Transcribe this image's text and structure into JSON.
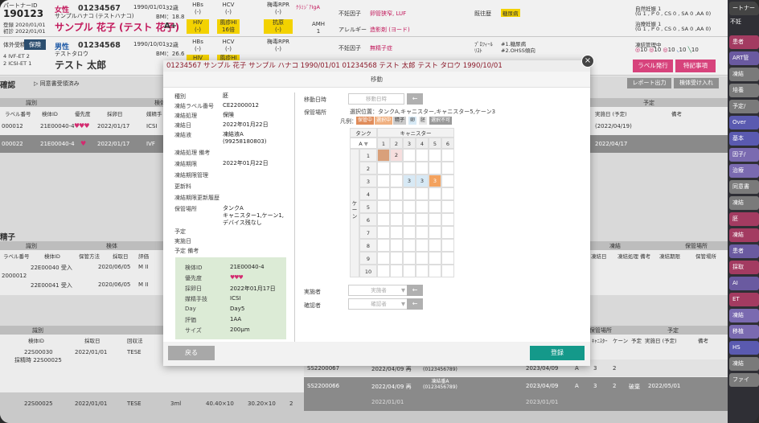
{
  "patients": [
    {
      "id_label": "パートナーID",
      "id": "190123",
      "reg_date_1": "登録 2020/01/01",
      "reg_date_2": "初診 2022/01/01",
      "sex": "女性",
      "card": "01234567",
      "kana": "サンプルハナコ (テストハナコ)",
      "name": "サンプル 花子 (テスト 花子)",
      "blood": "A+",
      "dob": "1990/01/01",
      "age": "32歳",
      "bmi": "BMI：18.8"
    },
    {
      "flow_label": "体外受精",
      "insurance": "保険",
      "sex": "男性",
      "card": "01234568",
      "kana": "テストタロウ",
      "name": "テスト 太郎",
      "dob": "1990/10/01",
      "age": "32歳",
      "bmi": "BMI：26.6",
      "side_1": "4  IVF-ET 2",
      "side_2": "2  ICSI-ET 1"
    }
  ],
  "infection": {
    "hdr": [
      "HBs",
      "HCV",
      "梅毒RPR"
    ],
    "p1": [
      "(-)",
      "(-)",
      "(-)"
    ],
    "hdr2": [
      "HIV",
      "風疹HI",
      "抗原"
    ],
    "p1b": [
      "(-)",
      "16倍",
      "(-)"
    ],
    "p2": [
      "(-)",
      "(-)",
      "(-)"
    ],
    "hdr3": [
      "HBs",
      "HCV",
      "梅毒RPR"
    ],
    "hdr4": [
      "HIV",
      "風疹HI"
    ]
  },
  "clinical": {
    "chlamydia_label": "ｸﾗﾐｼﾞｱIgA",
    "amh_label": "AMH",
    "amh_value": "1",
    "infertility_label": "不妊因子",
    "infertility_value": "卵管狭窄, LUF",
    "allergy_label": "アレルギー",
    "allergy_value": "造影剤 (ヨード)",
    "history_label": "既往歴",
    "history_value": "糖尿病",
    "male_factor_label": "不妊因子",
    "male_factor_value": "無精子症",
    "profile_label": "ﾌﾟﾛﾌｨｰﾙ\nﾘｽﾄ",
    "profile_value": "#1.糖尿病\n#2.OHSS傾向",
    "natural_1": "自然妊娠 1",
    "natural_1_detail": "(G 1 , P 0 , CS 0 , SA 0 ,AA 0)",
    "treatment_1": "治療妊娠 1",
    "treatment_1_detail": "(G 1 , P 0 , CS 0 , SA 0 ,AA 0)",
    "frozen_label": "凍結管理中",
    "frozen_counts": [
      "10",
      "10",
      "10",
      "10",
      "10"
    ]
  },
  "toolbar": {
    "label_print": "ラベル発行",
    "special": "特記事項",
    "report": "レポート出力",
    "accept": "検体受け入れ",
    "confirm_title": "確認",
    "consent": "▷ 同意書受領済み"
  },
  "sidebar_items": [
    "ートナー",
    "不妊",
    "患者",
    "ART管",
    "凍結",
    "培養",
    "予定/",
    "Over",
    "基本",
    "因子/",
    "治療",
    "同意書",
    "凍結",
    "胚",
    "凍結",
    "患者",
    "採取",
    "AI",
    "ET",
    "凍結",
    "移植",
    "HS",
    "凍結",
    "ファイ"
  ],
  "sidebar_flag": "不妊",
  "bg_table1": {
    "hdr_left": "識別",
    "hdr_mid": "検体",
    "cols": [
      "ラベル番号",
      "検体ID",
      "優先度",
      "採卵日",
      "媒精手"
    ],
    "rows": [
      [
        "000012",
        "21E00040-4",
        "♥♥♥",
        "2022/01/17",
        "ICSI"
      ],
      [
        "000022",
        "21E00040-4",
        "♥",
        "2022/01/17",
        "IVF"
      ]
    ],
    "right_hdr": "予定",
    "right_cols": [
      "実施日 (予定)",
      "備考"
    ],
    "right_rows": [
      "(2022/04/19)",
      "2022/04/17"
    ]
  },
  "bg_table2": {
    "section": "精子",
    "hdr_left": "識別",
    "hdr_mid": "検体",
    "cols": [
      "ラベル番号",
      "検体ID",
      "保管方法",
      "採取日",
      "評価"
    ],
    "group": "2000012",
    "rows": [
      [
        "22E00040 受入",
        "2020/06/05",
        "M II"
      ],
      [
        "22E00041 受入",
        "2020/06/05",
        "M II"
      ]
    ],
    "right_hdr": "凍結",
    "right_hdr2": "保管場所",
    "right_cols": [
      "凍結日",
      "凍結処理 備考",
      "凍結期限",
      "保管場所"
    ]
  },
  "bg_table3": {
    "hdr": "識別",
    "cols": [
      "検体ID",
      "採取日",
      "回収法"
    ],
    "rows": [
      [
        "22S00030",
        "2022/01/01",
        "TESE"
      ],
      [
        "22S00025",
        "2022/01/01",
        "TESE"
      ]
    ],
    "sub": "採精時 22S00025",
    "extra": [
      "3ml",
      "40.40×10",
      "30.20×10",
      "2"
    ],
    "storage_hdr": "保管場所",
    "storage_cols": [
      "ﾀﾝｸ",
      "ｷｬﾆｽﾀｰ",
      "ケーン",
      "予定",
      "実施日 (予定)",
      "備考"
    ],
    "s_rows": [
      [
        "SS2200067",
        "2022/04/09 再",
        "凍結番A\n(0123456789)",
        "2023/04/09",
        "A",
        "3",
        "2",
        "",
        ""
      ],
      [
        "SS2200066",
        "2022/04/09 再",
        "凍結番A\n(0123456789)",
        "2023/04/09",
        "A",
        "3",
        "2",
        "破棄",
        "2022/05/01"
      ],
      [
        "",
        "2022/01/01",
        "",
        "2023/01/01",
        "",
        "",
        "",
        "",
        ""
      ]
    ]
  },
  "modal": {
    "title": "01234567 サンプル 花子 サンプル ハナコ 1990/01/01 01234568 テスト 太郎 テスト タロウ 1990/10/01",
    "subtitle": "移動",
    "close": "×",
    "fields": [
      {
        "label": "種別",
        "value": "胚"
      },
      {
        "label": "凍結ラベル番号",
        "value": "CE22000012"
      },
      {
        "label": "凍結処理",
        "value": "保険"
      },
      {
        "label": "凍結日",
        "value": "2022年01月22日"
      },
      {
        "label": "凍結液",
        "value": "凍結液A\n(99258180803)"
      },
      {
        "label": "凍結処理 備考",
        "value": ""
      },
      {
        "label": "凍結期限",
        "value": "2022年01月22日"
      },
      {
        "label": "凍結期限管理",
        "value": ""
      },
      {
        "label": "更新料",
        "value": ""
      },
      {
        "label": "凍結期限更新履歴",
        "value": ""
      },
      {
        "label": "保管場所",
        "value": "タンクA\nキャニスター1,ケーン1,\nデバイス残なし"
      },
      {
        "label": "予定",
        "value": ""
      },
      {
        "label": "実施日",
        "value": ""
      },
      {
        "label": "予定 備考",
        "value": ""
      }
    ],
    "detail": [
      {
        "label": "検体ID",
        "value": "21E00040-4"
      },
      {
        "label": "優先度",
        "value": "♥♥♥"
      },
      {
        "label": "採卵日",
        "value": "2022年01月17日"
      },
      {
        "label": "媒精手技",
        "value": "ICSI"
      },
      {
        "label": "Day",
        "value": "Day5"
      },
      {
        "label": "評価",
        "value": "1AA"
      },
      {
        "label": "サイズ",
        "value": "200μm"
      }
    ],
    "move_date_label": "移動日時",
    "move_date_placeholder": "移動日時",
    "storage_label": "保管場所",
    "selected_position": "選択位置：タンクA,キャニスター,キャニスター5,ケーン3",
    "legend_label": "凡例：",
    "legend": [
      {
        "text": "保管中",
        "color": "#e08c5a"
      },
      {
        "text": "選択中",
        "color": "#f0b080"
      },
      {
        "text": "精子",
        "color": "#c9c9c9"
      },
      {
        "text": "卵",
        "color": "#d7e9f5"
      },
      {
        "text": "胚",
        "color": "#e7e7e7"
      },
      {
        "text": "選択不可",
        "color": "#9a9a9a"
      }
    ],
    "tank_label": "タンク",
    "canister_label": "キャニスター",
    "tank_value": "A",
    "cane_label": "ケーン",
    "col_headers": [
      "1",
      "2",
      "3",
      "4",
      "5",
      "6"
    ],
    "row_headers": [
      "1",
      "2",
      "3",
      "4",
      "5",
      "6",
      "7",
      "8",
      "9",
      "10"
    ],
    "cells": [
      {
        "row": 0,
        "col": 0,
        "text": "",
        "state": "stored"
      },
      {
        "row": 0,
        "col": 1,
        "text": "2",
        "state": "egg-pink"
      },
      {
        "row": 2,
        "col": 2,
        "text": "3",
        "state": "egg"
      },
      {
        "row": 2,
        "col": 3,
        "text": "3",
        "state": "egg"
      },
      {
        "row": 2,
        "col": 4,
        "text": "3",
        "state": "selected"
      }
    ],
    "operator_label": "実施者",
    "operator_placeholder": "実施者",
    "checker_label": "確認者",
    "checker_placeholder": "確認者",
    "back": "戻る",
    "register": "登録",
    "arrow": "←"
  }
}
